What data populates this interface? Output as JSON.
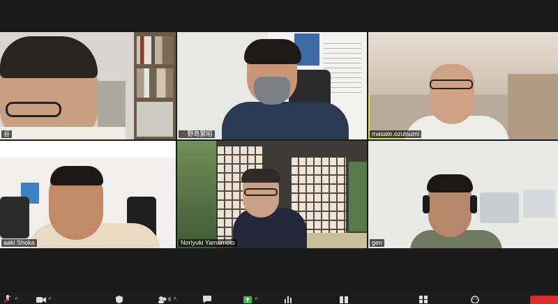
{
  "participants": [
    {
      "name": "谷",
      "muted": false
    },
    {
      "name": "野島繁昭",
      "muted": true
    },
    {
      "name": "masato.ozutsumi",
      "muted": false,
      "active_speaker": true
    },
    {
      "name": "aaki Shoka",
      "muted": false
    },
    {
      "name": "Noriyuki Yamamoto",
      "muted": false
    },
    {
      "name": "gen",
      "muted": false
    }
  ],
  "toolbar": {
    "participants_count": "6"
  },
  "colors": {
    "background": "#1a1a1a",
    "active_speaker_border": "#d9e04a",
    "mute_red": "#e0342f",
    "end_button": "#d92c2c",
    "share_green": "#2fbf4f"
  },
  "icons": [
    "mute-icon",
    "video-icon",
    "security-icon",
    "participants-icon",
    "chat-icon",
    "share-screen-icon",
    "polls-icon",
    "record-icon",
    "breakout-rooms-icon",
    "reactions-icon"
  ]
}
